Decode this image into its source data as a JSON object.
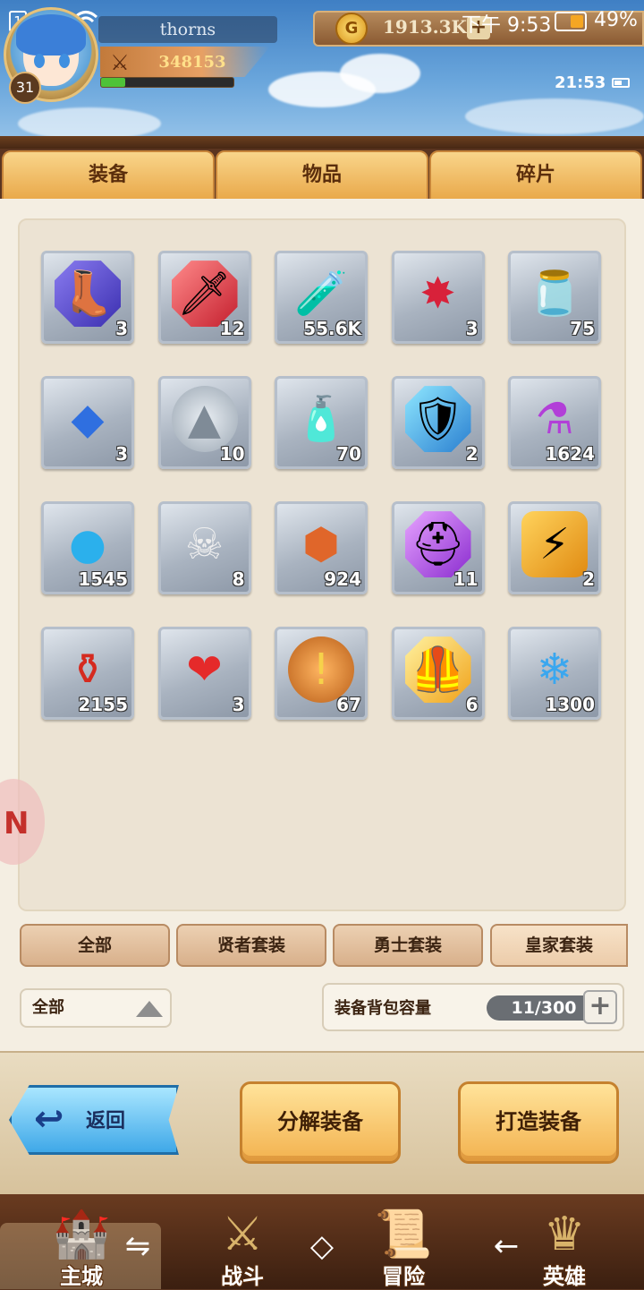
{
  "status_bar": {
    "sim1": "1",
    "sim2": "2",
    "time": "下午 9:53",
    "battery_percent": "49%",
    "battery_level": 0.49
  },
  "player": {
    "name": "thorns",
    "level": "31",
    "power": "348153",
    "exp_fraction": 0.18
  },
  "currency": {
    "gold": "1913.3K",
    "gold_icon": "G",
    "plus": "+"
  },
  "game_clock": "21:53",
  "tabs": [
    {
      "label": "装备"
    },
    {
      "label": "物品"
    },
    {
      "label": "碎片"
    }
  ],
  "items": [
    {
      "icon": "boot-gem-icon",
      "count": "3"
    },
    {
      "icon": "sword-gem-icon",
      "count": "12"
    },
    {
      "icon": "green-potion-icon",
      "count": "55.6K"
    },
    {
      "icon": "red-star-crystal-icon",
      "count": "3"
    },
    {
      "icon": "purple-jar-icon",
      "count": "75"
    },
    {
      "icon": "blue-crystal-shard-icon",
      "count": "3"
    },
    {
      "icon": "silver-coin-icon",
      "count": "10"
    },
    {
      "icon": "orange-vial-icon",
      "count": "70"
    },
    {
      "icon": "shield-gem-icon",
      "count": "2"
    },
    {
      "icon": "purple-flask-icon",
      "count": "1624"
    },
    {
      "icon": "blue-orb-icon",
      "count": "1545"
    },
    {
      "icon": "skull-box-icon",
      "count": "8"
    },
    {
      "icon": "ore-rock-icon",
      "count": "924"
    },
    {
      "icon": "helmet-gem-icon",
      "count": "11"
    },
    {
      "icon": "lightning-stone-icon",
      "count": "2"
    },
    {
      "icon": "red-potion-icon",
      "count": "2155"
    },
    {
      "icon": "heart-icon",
      "count": "3"
    },
    {
      "icon": "bronze-coin-icon",
      "count": "67"
    },
    {
      "icon": "armor-gem-icon",
      "count": "6"
    },
    {
      "icon": "ice-crystal-cluster-icon",
      "count": "1300"
    }
  ],
  "filters": [
    {
      "label": "全部"
    },
    {
      "label": "贤者套装"
    },
    {
      "label": "勇士套装"
    },
    {
      "label": "皇家套装"
    }
  ],
  "dropdown": {
    "selected": "全部"
  },
  "capacity": {
    "label": "装备背包容量",
    "value": "11/300",
    "plus": "+"
  },
  "actions": {
    "back": "返回",
    "decompose": "分解装备",
    "forge": "打造装备"
  },
  "bottom_nav": [
    {
      "label": "主城",
      "icon": "castle-icon"
    },
    {
      "label": "战斗",
      "icon": "crossed-swords-icon"
    },
    {
      "label": "冒险",
      "icon": "scroll-map-icon"
    },
    {
      "label": "英雄",
      "icon": "hero-crest-icon"
    }
  ],
  "colors": {
    "tab_bg": "#f9d58a",
    "panel_bg": "#f4eee2",
    "slot_border": "#b6bfcb",
    "accent_blue": "#3fa8e8",
    "action_gold": "#f3b24f"
  }
}
